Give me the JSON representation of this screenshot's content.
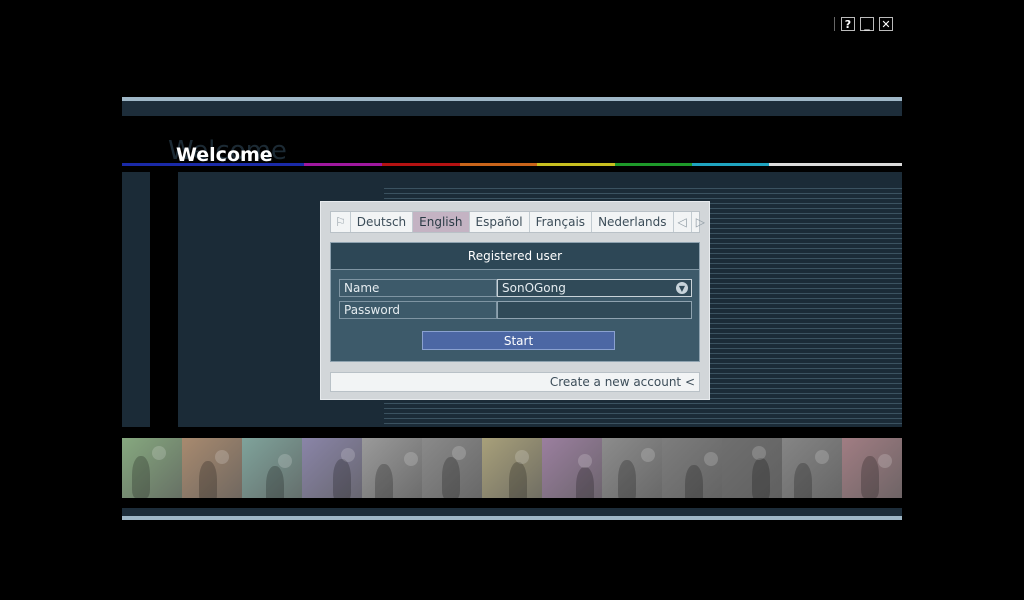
{
  "window_controls": {
    "help": "?",
    "minimize": "_",
    "close": "✕"
  },
  "page": {
    "title": "Welcome"
  },
  "color_line": [
    "#1a2aa8",
    "#000000",
    "#a0189f",
    "#b51212",
    "#c9641a",
    "#c8c020",
    "#1e9a2a",
    "#1fa4c0",
    "#dcdcdc"
  ],
  "languages": {
    "items": [
      "Deutsch",
      "English",
      "Español",
      "Français",
      "Nederlands"
    ],
    "selected": "English",
    "flag_icon": "flag-icon",
    "prev_icon": "arrow-left-icon",
    "next_icon": "arrow-right-icon"
  },
  "login": {
    "header": "Registered user",
    "name_label": "Name",
    "name_value": "SonOGong",
    "password_label": "Password",
    "password_value": "",
    "start_label": "Start"
  },
  "create_account": {
    "label": "Create a new account <"
  },
  "photo_strip": {
    "tints": [
      "#86a87f",
      "#a88a6f",
      "#7fa39b",
      "#8a85a8",
      "#9a9a9a",
      "#8a8a8a",
      "#a8a07a",
      "#9b7f9f",
      "#8c8c8c",
      "#7d7d7d",
      "#6f6f6f",
      "#858585",
      "#a17d83"
    ]
  }
}
